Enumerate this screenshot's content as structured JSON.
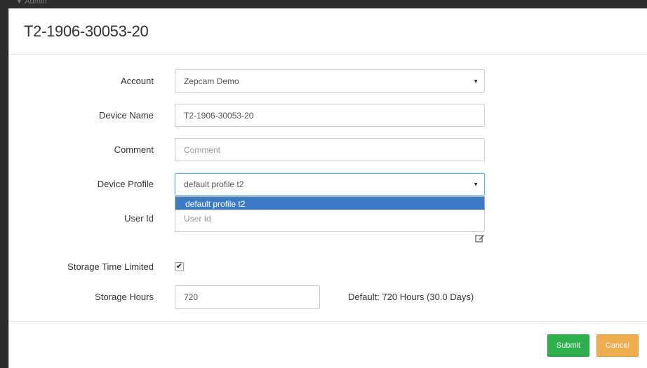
{
  "dialog": {
    "title": "T2-1906-30053-20"
  },
  "form": {
    "account": {
      "label": "Account",
      "value": "Zepcam Demo"
    },
    "device_name": {
      "label": "Device Name",
      "value": "T2-1906-30053-20"
    },
    "comment": {
      "label": "Comment",
      "placeholder": "Comment"
    },
    "device_profile": {
      "label": "Device Profile",
      "value": "default profile t2",
      "options": [
        "default profile t2"
      ]
    },
    "user_id": {
      "label": "User Id",
      "placeholder": "User Id"
    },
    "storage_time_limited": {
      "label": "Storage Time Limited",
      "checked": true,
      "check_glyph": "✔"
    },
    "storage_hours": {
      "label": "Storage Hours",
      "value": "720",
      "hint": "Default: 720 Hours (30.0 Days)"
    }
  },
  "footer": {
    "submit_label": "Submit",
    "cancel_label": "Cancel"
  },
  "icons": {
    "dropdown_caret": "▼",
    "edit": "edit-icon"
  },
  "colors": {
    "submit": "#2fb04f",
    "cancel": "#f0ad4e",
    "selected_option": "#3d7bc7",
    "focus_border": "#66afe9"
  }
}
